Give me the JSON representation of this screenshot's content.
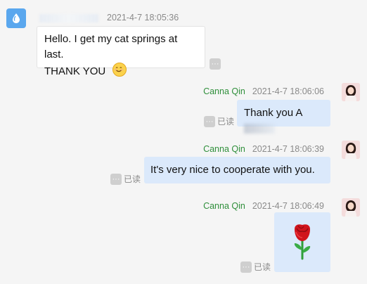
{
  "messages": [
    {
      "direction": "incoming",
      "timestamp": "2021-4-7 18:05:36",
      "lines": [
        "Hello. I get my cat springs at last.",
        "THANK YOU"
      ],
      "emoji": "smiling-face"
    },
    {
      "direction": "outgoing",
      "sender": "Canna Qin",
      "timestamp": "2021-4-7 18:06:06",
      "text": "Thank you A",
      "read_label": "已读"
    },
    {
      "direction": "outgoing",
      "sender": "Canna Qin",
      "timestamp": "2021-4-7 18:06:39",
      "text": "It's very nice to cooperate with you.",
      "read_label": "已读"
    },
    {
      "direction": "outgoing",
      "sender": "Canna Qin",
      "timestamp": "2021-4-7 18:06:49",
      "emoji": "rose",
      "read_label": "已读"
    }
  ],
  "colors": {
    "background": "#f5f5f5",
    "outgoing_bubble": "#dbe9fb",
    "incoming_bubble": "#ffffff",
    "sender_name": "#2f8f3b",
    "meta_text": "#8a8a8a",
    "contact_avatar": "#5aa7ee"
  },
  "icons": {
    "contact_avatar": "water-drop-icon",
    "more_options": "more-options-icon",
    "rose": "rose-emoji-icon",
    "smile": "smiling-face-emoji-icon"
  }
}
